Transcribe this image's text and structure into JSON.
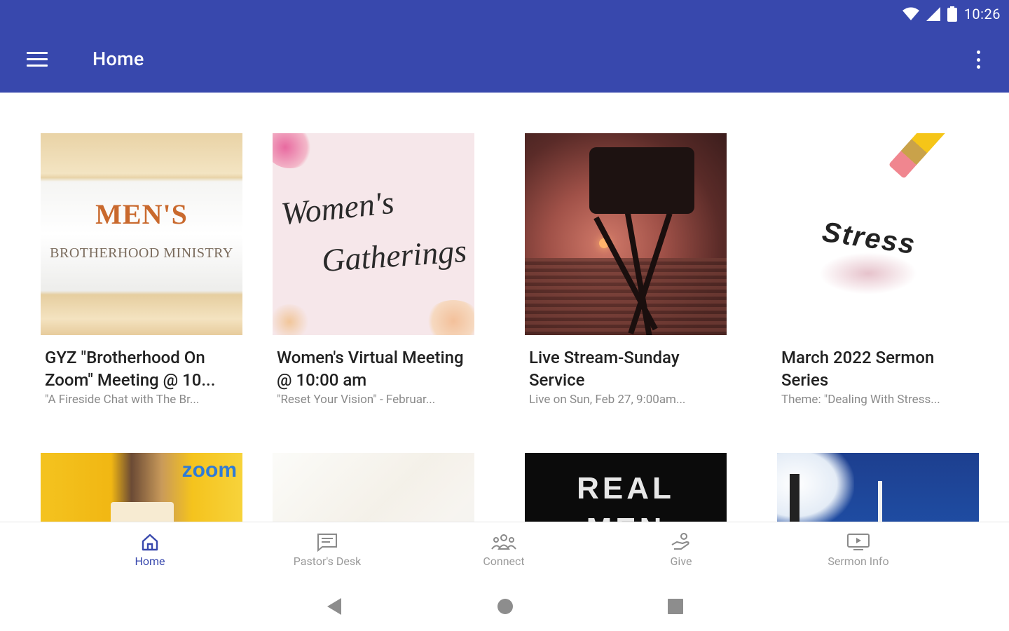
{
  "status_bar": {
    "time": "10:26",
    "icons": [
      "wifi-icon",
      "signal-icon",
      "battery-icon"
    ]
  },
  "app_bar": {
    "title": "Home",
    "menu_icon": "hamburger-menu-icon",
    "overflow_icon": "more-vert-icon",
    "color": "#3848ad"
  },
  "cards": [
    {
      "title": "GYZ \"Brotherhood On Zoom\" Meeting @ 10...",
      "subtitle": "\"A Fireside Chat with The Br...",
      "thumb_line1": "MEN'S",
      "thumb_line2": "BROTHERHOOD MINISTRY"
    },
    {
      "title": "Women's Virtual Meeting @ 10:00 am",
      "subtitle": "\"Reset Your Vision\" - Februar...",
      "thumb_line1": "Women's",
      "thumb_line2": "Gatherings"
    },
    {
      "title": "Live Stream-Sunday Service",
      "subtitle": "Live on Sun, Feb 27, 9:00am..."
    },
    {
      "title": "March 2022 Sermon Series",
      "subtitle": "Theme: \"Dealing With Stress...",
      "thumb_line1": "Stress"
    },
    {
      "thumb_line1": "zoom"
    },
    {},
    {
      "thumb_line1": "REAL",
      "thumb_line2": "MEN"
    },
    {}
  ],
  "bottom_nav": [
    {
      "label": "Home",
      "icon": "home-icon",
      "active": true
    },
    {
      "label": "Pastor's Desk",
      "icon": "message-icon",
      "active": false
    },
    {
      "label": "Connect",
      "icon": "group-icon",
      "active": false
    },
    {
      "label": "Give",
      "icon": "give-hand-icon",
      "active": false
    },
    {
      "label": "Sermon Info",
      "icon": "video-icon",
      "active": false
    }
  ],
  "system_nav": [
    "back-icon",
    "home-circle-icon",
    "recents-icon"
  ]
}
